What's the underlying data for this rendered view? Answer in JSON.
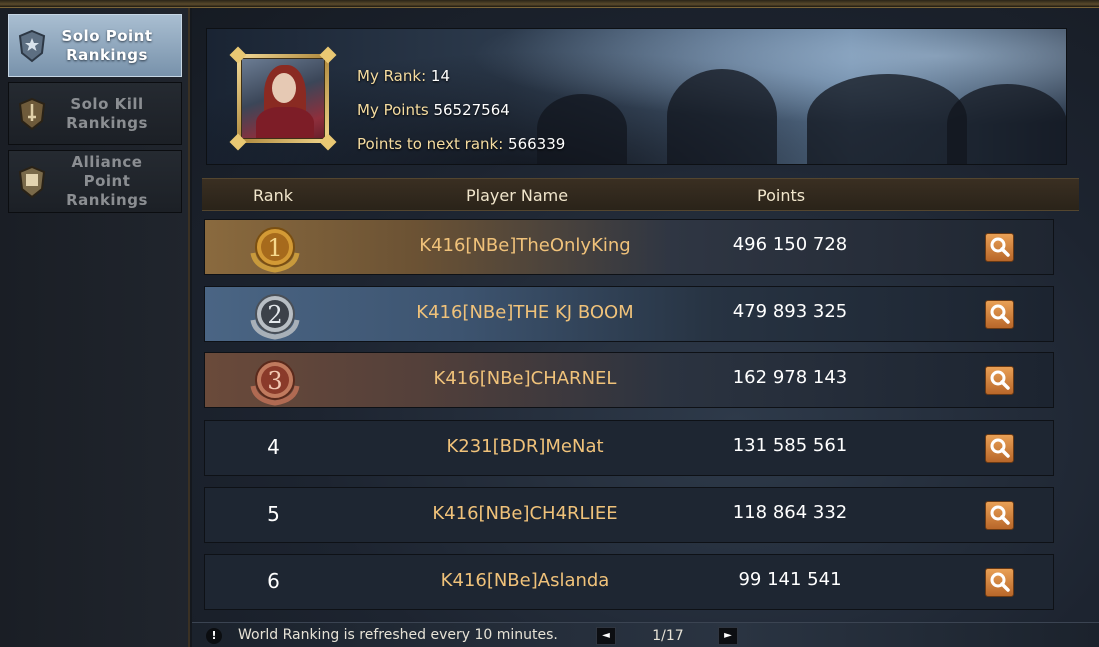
{
  "sidebar": {
    "items": [
      {
        "label": "Solo Point Rankings",
        "icon": "shield-star-icon",
        "active": true
      },
      {
        "label": "Solo Kill Rankings",
        "icon": "shield-sword-icon",
        "active": false
      },
      {
        "label": "Alliance Point Rankings",
        "icon": "shield-banner-icon",
        "active": false
      }
    ]
  },
  "player": {
    "rank_label": "My Rank:",
    "rank_value": "14",
    "points_label": "My Points",
    "points_value": "56527564",
    "next_label": "Points to next rank:",
    "next_value": "566339"
  },
  "table": {
    "headers": {
      "rank": "Rank",
      "name": "Player Name",
      "points": "Points"
    },
    "rows": [
      {
        "rank": "1",
        "name": "K416[NBe]TheOnlyKing",
        "points": "496 150 728",
        "medal": "gold"
      },
      {
        "rank": "2",
        "name": "K416[NBe]THE KJ BOOM",
        "points": "479 893 325",
        "medal": "silver"
      },
      {
        "rank": "3",
        "name": "K416[NBe]CHARNEL",
        "points": "162 978 143",
        "medal": "bronze"
      },
      {
        "rank": "4",
        "name": "K231[BDR]MeNat",
        "points": "131 585 561"
      },
      {
        "rank": "5",
        "name": "K416[NBe]CH4RLIEE",
        "points": "118 864 332"
      },
      {
        "rank": "6",
        "name": "K416[NBe]Aslanda",
        "points": "99 141 541"
      }
    ]
  },
  "footer": {
    "info_icon": "!",
    "notice": "World Ranking is refreshed every 10 minutes.",
    "prev_icon": "◄",
    "next_icon": "►",
    "page": "1/17"
  },
  "colors": {
    "accent_gold": "#f0c27a",
    "active_tab": "#8fa8c0",
    "search_button": "#d98a44"
  }
}
